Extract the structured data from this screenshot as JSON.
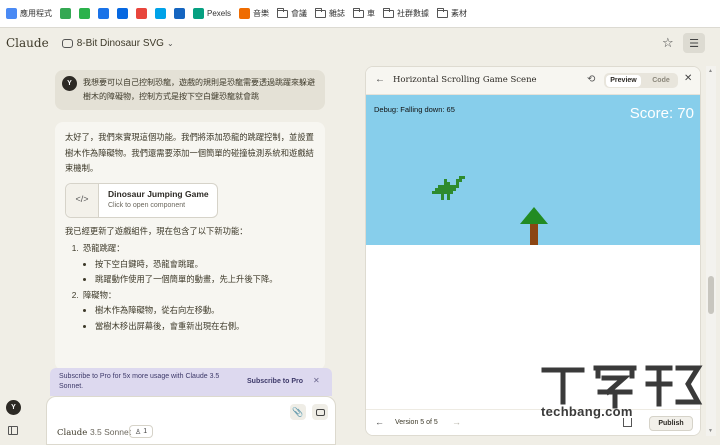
{
  "bookmarks": [
    {
      "label": "應用程式",
      "icon": "apps-grid-icon",
      "color": "#4a8af4"
    },
    {
      "label": "",
      "icon": "puzzle-icon",
      "color": "#34a853"
    },
    {
      "label": "",
      "icon": "feedly-icon",
      "color": "#2bb24c"
    },
    {
      "label": "",
      "icon": "c-icon",
      "color": "#1a73e8"
    },
    {
      "label": "",
      "icon": "meta-icon",
      "color": "#0668e1"
    },
    {
      "label": "",
      "icon": "trend-icon",
      "color": "#e8453c"
    },
    {
      "label": "",
      "icon": "s-icon",
      "color": "#00a2e8"
    },
    {
      "label": "",
      "icon": "square-icon",
      "color": "#1565c0"
    },
    {
      "label": "Pexels",
      "icon": "pexels-icon",
      "color": "#05a081"
    },
    {
      "label": "音樂",
      "icon": "music-icon",
      "color": "#ef6c00"
    },
    {
      "label": "會議",
      "icon": "folder-icon",
      "color": ""
    },
    {
      "label": "雜誌",
      "icon": "folder-icon",
      "color": ""
    },
    {
      "label": "車",
      "icon": "folder-icon",
      "color": ""
    },
    {
      "label": "社群數據",
      "icon": "folder-icon",
      "color": ""
    },
    {
      "label": "素材",
      "icon": "folder-icon",
      "color": ""
    }
  ],
  "header": {
    "brand": "Claude",
    "title": "8-Bit Dinosaur SVG",
    "chevron": "⌄"
  },
  "user_message": {
    "avatar": "Y",
    "text": "我想要可以自己控制恐龍，遊戲的規則是恐龍需要透過跳躍來躲避樹木的障礙物，控制方式是按下空白鍵恐龍就會跳"
  },
  "assistant": {
    "intro": "太好了，我們來實現這個功能。我們將添加恐龍的跳躍控制，並設置樹木作為障礙物。我們還需要添加一個簡單的碰撞檢測系統和遊戲結束機制。",
    "card": {
      "title": "Dinosaur Jumping Game",
      "subtitle": "Click to open component",
      "icon": "</>"
    },
    "summary": "我已經更新了遊戲組件，現在包含了以下新功能：",
    "points": [
      {
        "title": "恐龍跳躍：",
        "subs": [
          "按下空白鍵時，恐龍會跳躍。",
          "跳躍動作使用了一個簡單的動畫，先上升後下降。"
        ]
      },
      {
        "title": "障礙物：",
        "subs": [
          "樹木作為障礙物，從右向左移動。",
          "當樹木移出屏幕後，會重新出現在右側。"
        ]
      }
    ]
  },
  "pro_banner": {
    "text": "Subscribe to Pro for 5x more usage with Claude 3.5 Sonnet.",
    "link": "Subscribe to Pro",
    "close": "✕"
  },
  "composer": {
    "model": "Claude",
    "model_version": "3.5 Sonnet",
    "style_count": "1"
  },
  "artifact": {
    "title": "Horizontal Scrolling Game Scene",
    "tabs": {
      "preview": "Preview",
      "code": "Code"
    },
    "debug": "Debug: Falling down: 65",
    "score": "Score: 70",
    "version": "Version 5 of 5",
    "publish": "Publish",
    "sky_color": "#87ceeb",
    "dino_color": "#2e8b2e",
    "tree_leaf_color": "#228b22",
    "tree_trunk_color": "#8b4513"
  },
  "watermark": {
    "logo": "T客邦",
    "url": "techbang.com"
  }
}
